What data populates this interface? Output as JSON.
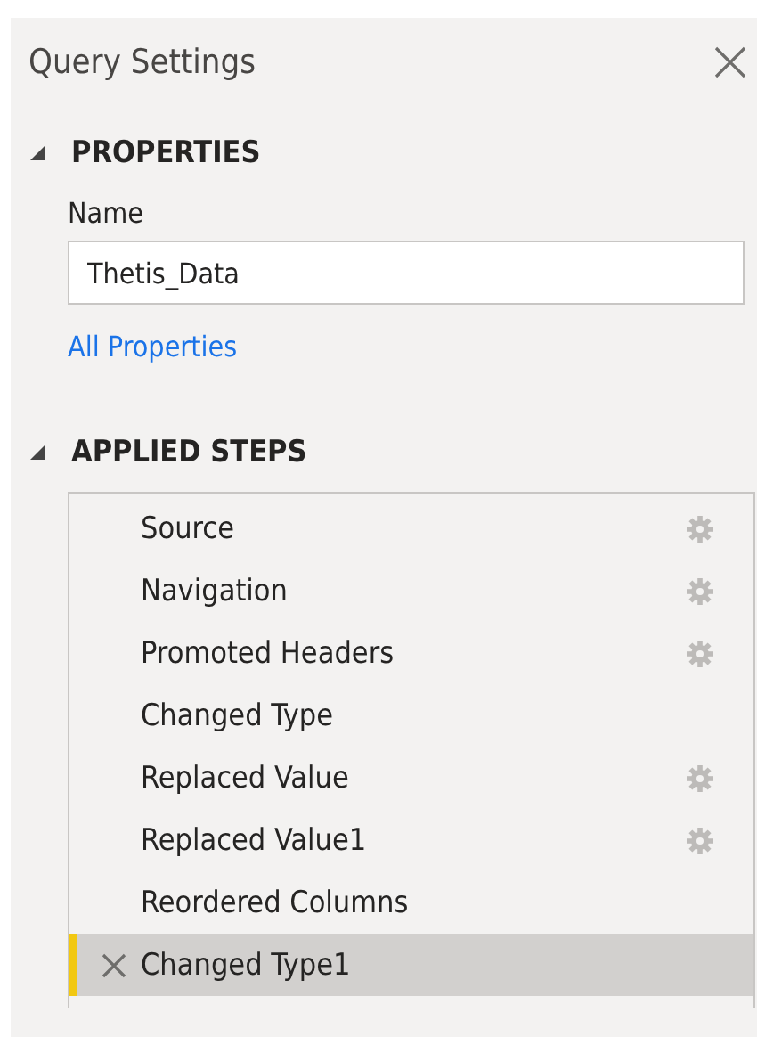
{
  "panel": {
    "title": "Query Settings"
  },
  "properties": {
    "heading": "PROPERTIES",
    "expanded": true,
    "name_label": "Name",
    "name_value": "Thetis_Data",
    "link": "All Properties"
  },
  "applied_steps": {
    "heading": "APPLIED STEPS",
    "expanded": true,
    "steps": [
      {
        "label": "Source",
        "has_settings": true,
        "selected": false
      },
      {
        "label": "Navigation",
        "has_settings": true,
        "selected": false
      },
      {
        "label": "Promoted Headers",
        "has_settings": true,
        "selected": false
      },
      {
        "label": "Changed Type",
        "has_settings": false,
        "selected": false
      },
      {
        "label": "Replaced Value",
        "has_settings": true,
        "selected": false
      },
      {
        "label": "Replaced Value1",
        "has_settings": true,
        "selected": false
      },
      {
        "label": "Reordered Columns",
        "has_settings": false,
        "selected": false
      },
      {
        "label": "Changed Type1",
        "has_settings": false,
        "selected": true
      }
    ]
  }
}
